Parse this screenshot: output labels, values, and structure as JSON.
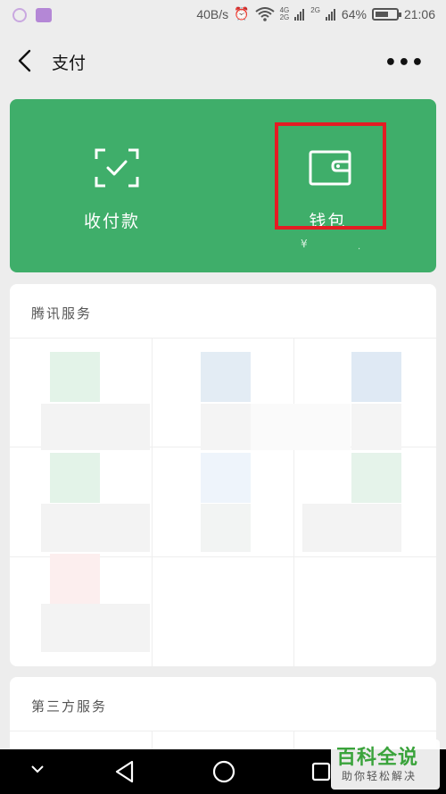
{
  "status_bar": {
    "net_speed": "40B/s",
    "net_4g_top": "4G",
    "net_4g_bottom": "2G",
    "net_2g": "2G",
    "battery_percent": "64%",
    "time": "21:06"
  },
  "nav": {
    "title": "支付",
    "more": "•••"
  },
  "pay_card": {
    "left_label": "收付款",
    "right_label": "钱包",
    "wallet_balance_prefix": "¥",
    "wallet_dot": "."
  },
  "sections": {
    "tencent_title": "腾讯服务",
    "third_party_title": "第三方服务"
  },
  "watermark": {
    "title": "百科全说",
    "subtitle": "助你轻松解决"
  },
  "colors": {
    "card_green": "#3fae6a",
    "highlight_red": "#e41c23",
    "watermark_green": "#3aa33b"
  }
}
